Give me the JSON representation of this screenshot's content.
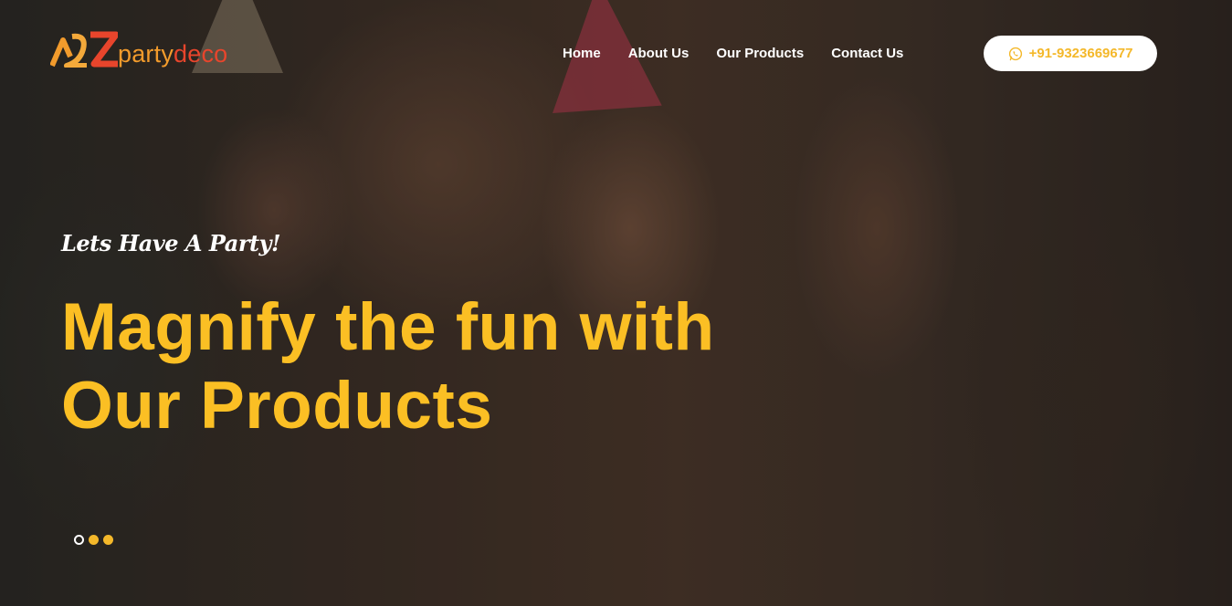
{
  "brand": {
    "logo_text_part1": "party",
    "logo_text_part2": "deco",
    "logo_mark": "AZ"
  },
  "nav": {
    "items": [
      "Home",
      "About Us",
      "Our Products",
      "Contact Us"
    ]
  },
  "contact": {
    "phone": "+91-9323669677",
    "icon": "whatsapp-icon"
  },
  "hero": {
    "tagline": "Lets Have A Party!",
    "headline_line1": "Magnify the fun with",
    "headline_line2": "Our Products"
  },
  "slider": {
    "count": 3,
    "active_index": 0
  },
  "colors": {
    "accent": "#fbbf24",
    "logo_orange": "#f29b2c",
    "logo_red": "#e8452c",
    "text": "#ffffff"
  }
}
